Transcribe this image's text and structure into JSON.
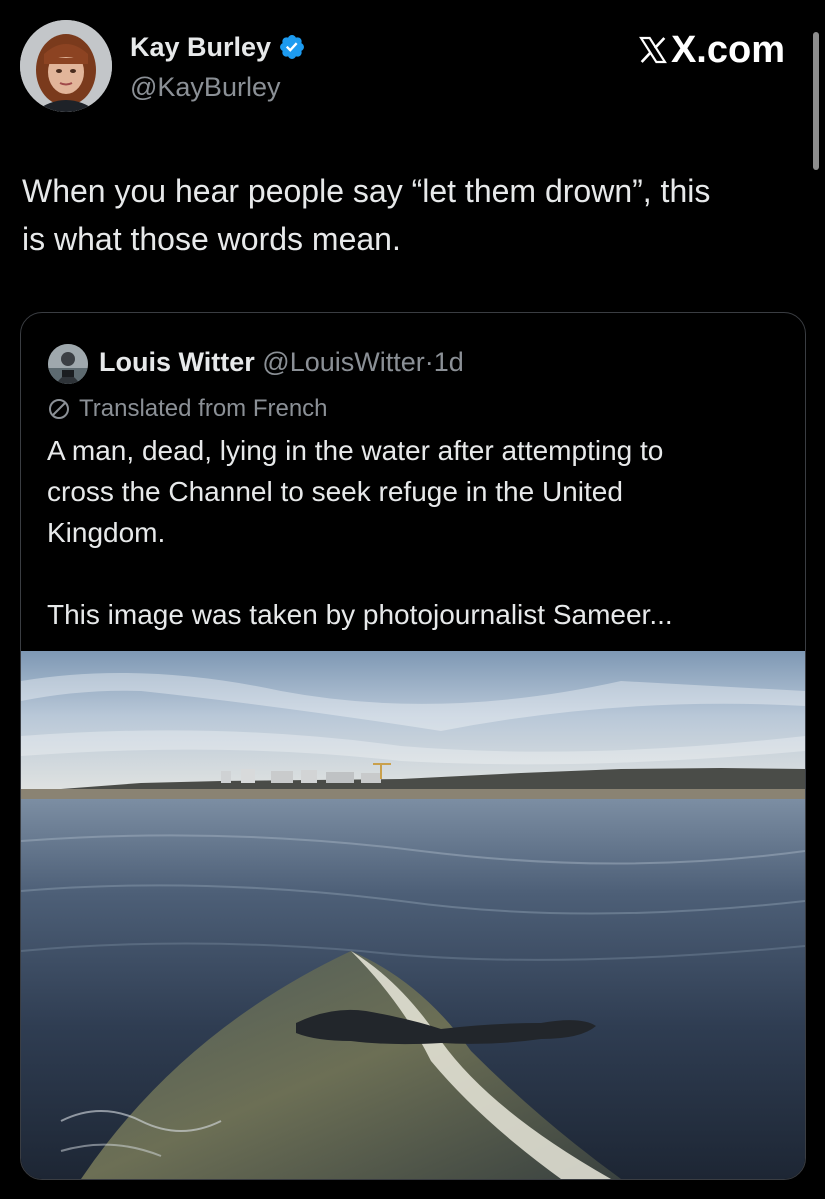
{
  "tweet": {
    "author": {
      "name": "Kay Burley",
      "handle": "@KayBurley",
      "avatar_icon": "profile-photo-avatar",
      "verified_icon": "verified-badge-icon",
      "verified_color": "#1d9bf0"
    },
    "brand": "X.com",
    "text": "When you hear people say “let them drown”, this\nis what those words mean."
  },
  "quote": {
    "author_name": "Louis Witter",
    "handle": "@LouisWitter",
    "separator": "·",
    "time": "1d",
    "translated_label": "Translated from French",
    "translate_icon": "globe-translate-icon",
    "text": "A man, dead, lying in the water after attempting to\ncross the Channel to seek refuge in the United\nKingdom.\n\nThis image was taken by photojournalist Sameer...",
    "image_icon": "beach-sea-photo"
  },
  "colors": {
    "background": "#000000",
    "primary_text": "#e7e9ea",
    "secondary_text": "#8b9096",
    "border": "#3a3d42",
    "verified": "#1d9bf0"
  }
}
